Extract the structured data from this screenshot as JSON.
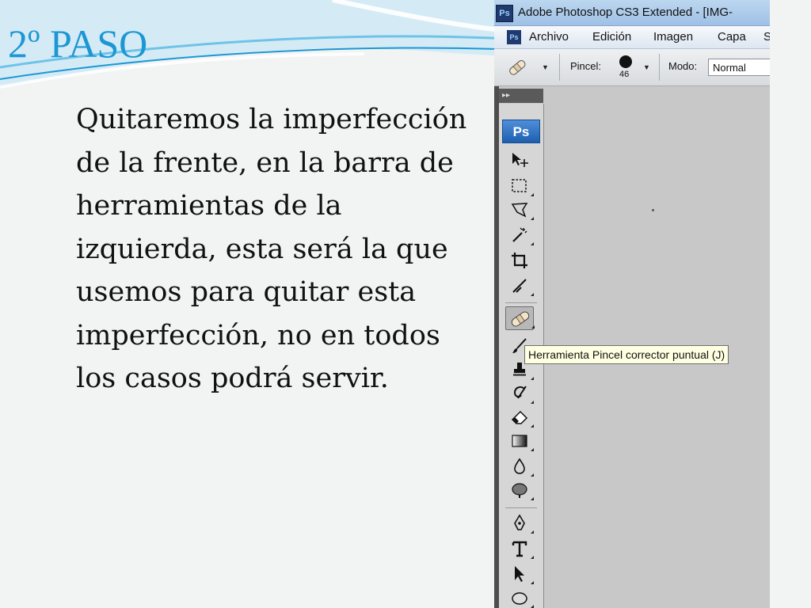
{
  "slide": {
    "title": "2º PASO",
    "body": "Quitaremos la imperfección de la frente, en la barra de herramientas de la izquierda, esta será la que usemos para quitar esta imperfección, no en todos los casos podrá servir.",
    "accent_color": "#1d97d4"
  },
  "photoshop": {
    "logo": "Ps",
    "window_title": "Adobe Photoshop CS3 Extended - [IMG-",
    "menu": [
      "Archivo",
      "Edición",
      "Imagen",
      "Capa",
      "S"
    ],
    "options_bar": {
      "brush_label": "Pincel:",
      "brush_size": "46",
      "mode_label": "Modo:",
      "mode_value": "Normal"
    },
    "toolbox_badge": "Ps",
    "tools": [
      "move-tool",
      "marquee-tool",
      "lasso-tool",
      "magic-wand-tool",
      "crop-tool",
      "slice-tool",
      "spot-healing-brush-tool",
      "brush-tool",
      "clone-stamp-tool",
      "history-brush-tool",
      "eraser-tool",
      "gradient-tool",
      "blur-tool",
      "dodge-tool",
      "pen-tool",
      "type-tool",
      "path-selection-tool",
      "ellipse-tool"
    ],
    "selected_tool": "spot-healing-brush-tool",
    "tooltip": "Herramienta Pincel corrector puntual (J)"
  }
}
